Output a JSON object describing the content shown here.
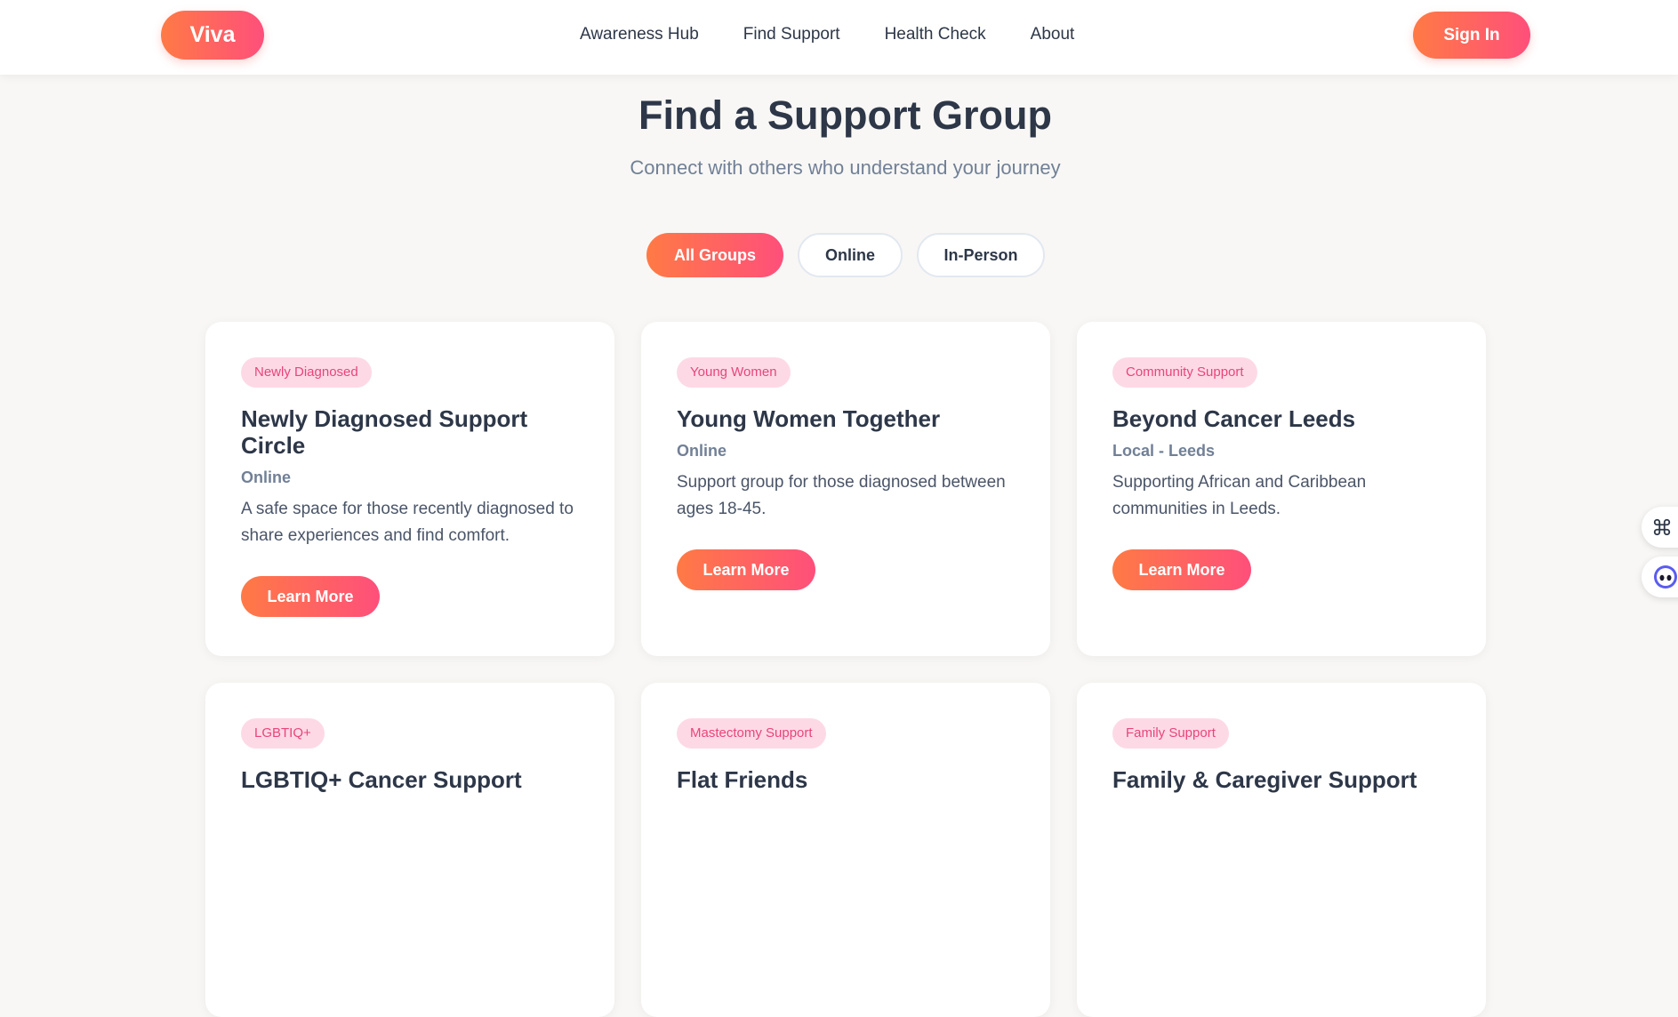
{
  "nav": {
    "logo": "Viva",
    "links": [
      "Awareness Hub",
      "Find Support",
      "Health Check",
      "About"
    ],
    "signin": "Sign In"
  },
  "hero": {
    "title": "Find a Support Group",
    "subtitle": "Connect with others who understand your journey"
  },
  "filters": {
    "all": "All Groups",
    "online": "Online",
    "inperson": "In-Person",
    "active": "All Groups"
  },
  "cards": [
    {
      "badge": "Newly Diagnosed",
      "title": "Newly Diagnosed Support Circle",
      "location": "Online",
      "description": "A safe space for those recently diagnosed to share experiences and find comfort.",
      "button": "Learn More"
    },
    {
      "badge": "Young Women",
      "title": "Young Women Together",
      "location": "Online",
      "description": "Support group for those diagnosed between ages 18-45.",
      "button": "Learn More"
    },
    {
      "badge": "Community Support",
      "title": "Beyond Cancer Leeds",
      "location": "Local - Leeds",
      "description": "Supporting African and Caribbean communities in Leeds.",
      "button": "Learn More"
    },
    {
      "badge": "LGBTIQ+",
      "title": "LGBTIQ+ Cancer Support",
      "location": "",
      "description": "",
      "button": ""
    },
    {
      "badge": "Mastectomy Support",
      "title": "Flat Friends",
      "location": "",
      "description": "",
      "button": ""
    },
    {
      "badge": "Family Support",
      "title": "Family & Caregiver Support",
      "location": "",
      "description": "",
      "button": ""
    }
  ],
  "side_widgets": {
    "top_icon": "command-icon",
    "bottom_icon": "assistant-face-icon"
  },
  "colors": {
    "accent_start": "#ff7a45",
    "accent_end": "#ff4f7b",
    "badge_bg": "#fdd9e6",
    "badge_text": "#e8457a",
    "page_bg": "#f8f7f5"
  }
}
